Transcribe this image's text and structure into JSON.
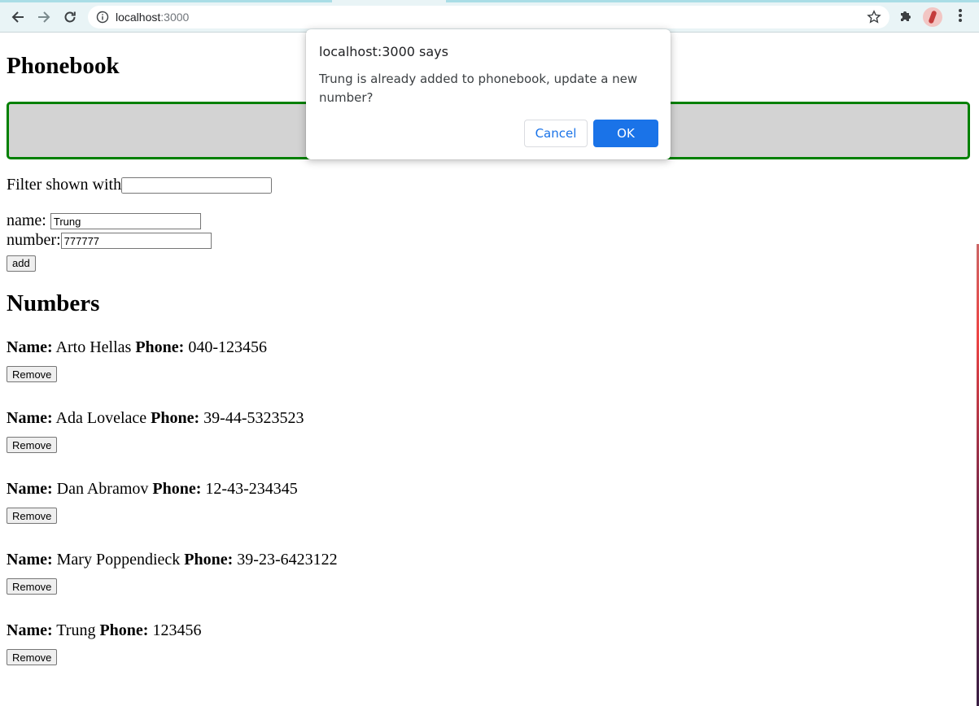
{
  "browser": {
    "url_host": "localhost",
    "url_port": ":3000"
  },
  "page": {
    "title": "Phonebook",
    "filter_label": "Filter shown with",
    "filter_value": "",
    "form": {
      "name_label": "name:",
      "name_value": "Trung",
      "number_label": "number:",
      "number_value": "777777",
      "add_label": "add"
    },
    "numbers_heading": "Numbers",
    "name_key": "Name:",
    "phone_key": "Phone:",
    "remove_label": "Remove",
    "persons": [
      {
        "name": "Arto Hellas",
        "phone": "040-123456"
      },
      {
        "name": "Ada Lovelace",
        "phone": "39-44-5323523"
      },
      {
        "name": "Dan Abramov",
        "phone": "12-43-234345"
      },
      {
        "name": "Mary Poppendieck",
        "phone": "39-23-6423122"
      },
      {
        "name": "Trung",
        "phone": "123456"
      }
    ]
  },
  "dialog": {
    "title": "localhost:3000 says",
    "message": "Trung is already added to phonebook, update a new number?",
    "cancel_label": "Cancel",
    "ok_label": "OK"
  },
  "colors": {
    "notification_border": "#008000",
    "notification_bg": "#d3d3d3",
    "ok_button": "#1a73e8"
  }
}
